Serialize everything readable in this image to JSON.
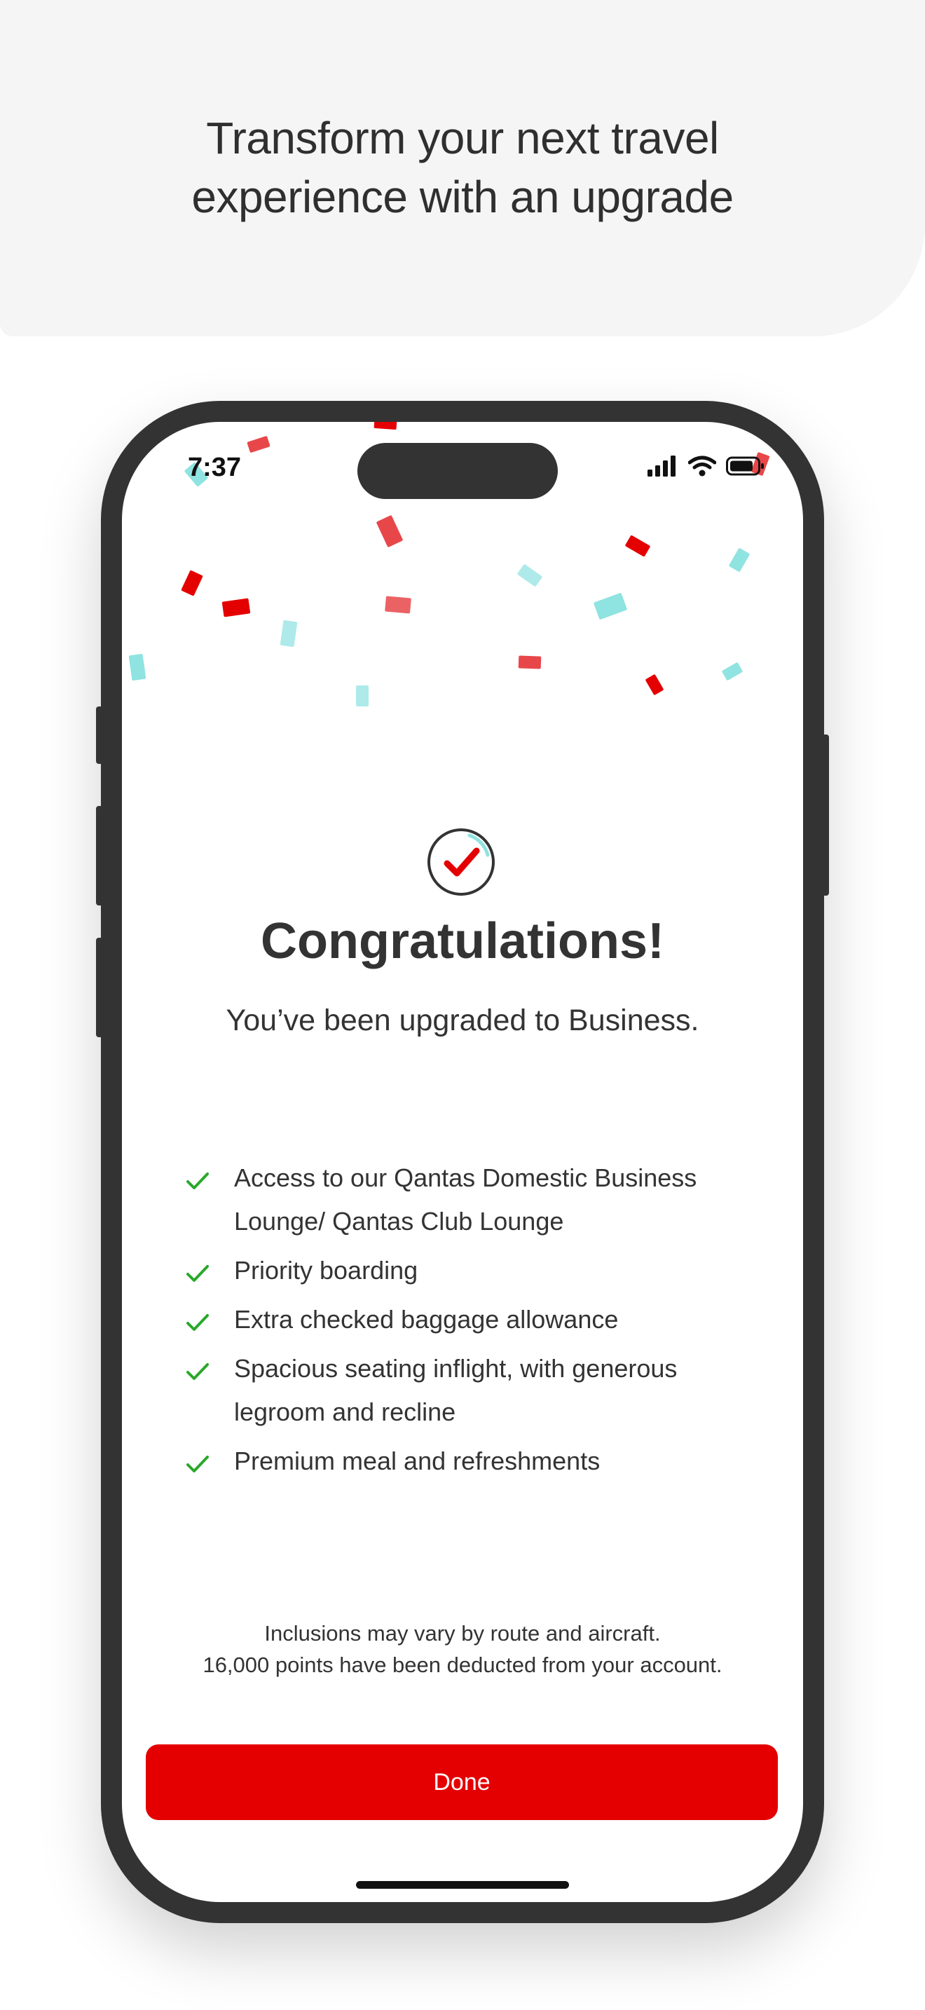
{
  "promo": {
    "headline_line1": "Transform your next travel",
    "headline_line2": "experience with an upgrade"
  },
  "status_bar": {
    "time": "7:37",
    "icons": [
      "signal-icon",
      "wifi-icon",
      "battery-icon"
    ]
  },
  "confirmation": {
    "icon": "check-circle-icon",
    "title": "Congratulations!",
    "subtitle": "You’ve been upgraded to Business."
  },
  "benefits": [
    "Access to our Qantas Domestic Business Lounge/ Qantas Club Lounge",
    "Priority boarding",
    "Extra checked baggage allowance",
    "Spacious seating inflight, with generous legroom and recline",
    "Premium meal and refreshments"
  ],
  "footnote": {
    "line1": "Inclusions may vary by route and aircraft.",
    "line2": "16,000 points have been deducted from your account."
  },
  "actions": {
    "done_label": "Done"
  },
  "colors": {
    "brand_red": "#e40000",
    "check_green": "#2aa82a",
    "confetti_red": "#e8474a",
    "confetti_teal": "#8fe3e0",
    "phone_frame": "#333333"
  }
}
